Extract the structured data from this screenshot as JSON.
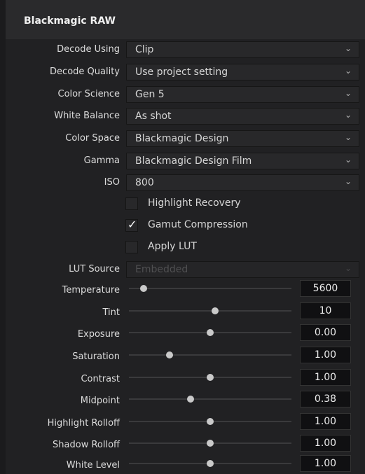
{
  "panel": {
    "title": "Blackmagic RAW"
  },
  "dropdowns": [
    {
      "label": "Decode Using",
      "value": "Clip"
    },
    {
      "label": "Decode Quality",
      "value": "Use project setting"
    },
    {
      "label": "Color Science",
      "value": "Gen 5"
    },
    {
      "label": "White Balance",
      "value": "As shot"
    },
    {
      "label": "Color Space",
      "value": "Blackmagic Design"
    },
    {
      "label": "Gamma",
      "value": "Blackmagic Design Film"
    },
    {
      "label": "ISO",
      "value": "800"
    }
  ],
  "checkboxes": [
    {
      "label": "Highlight Recovery",
      "checked": false
    },
    {
      "label": "Gamut Compression",
      "checked": true
    },
    {
      "label": "Apply LUT",
      "checked": false
    }
  ],
  "lut_source": {
    "label": "LUT Source",
    "value": "Embedded",
    "enabled": false
  },
  "sliders": [
    {
      "label": "Temperature",
      "value": "5600",
      "level": 0.09
    },
    {
      "label": "Tint",
      "value": "10",
      "level": 0.53
    },
    {
      "label": "Exposure",
      "value": "0.00",
      "level": 0.5
    },
    {
      "label": "Saturation",
      "value": "1.00",
      "level": 0.25
    },
    {
      "label": "Contrast",
      "value": "1.00",
      "level": 0.5
    },
    {
      "label": "Midpoint",
      "value": "0.38",
      "level": 0.38
    },
    {
      "label": "Highlight Rolloff",
      "value": "1.00",
      "level": 0.5
    },
    {
      "label": "Shadow Rolloff",
      "value": "1.00",
      "level": 0.5
    },
    {
      "label": "White Level",
      "value": "1.00",
      "level": 0.5
    }
  ],
  "icons": {
    "dropdown": "chevron-down-icon",
    "check": "checkmark-icon"
  }
}
